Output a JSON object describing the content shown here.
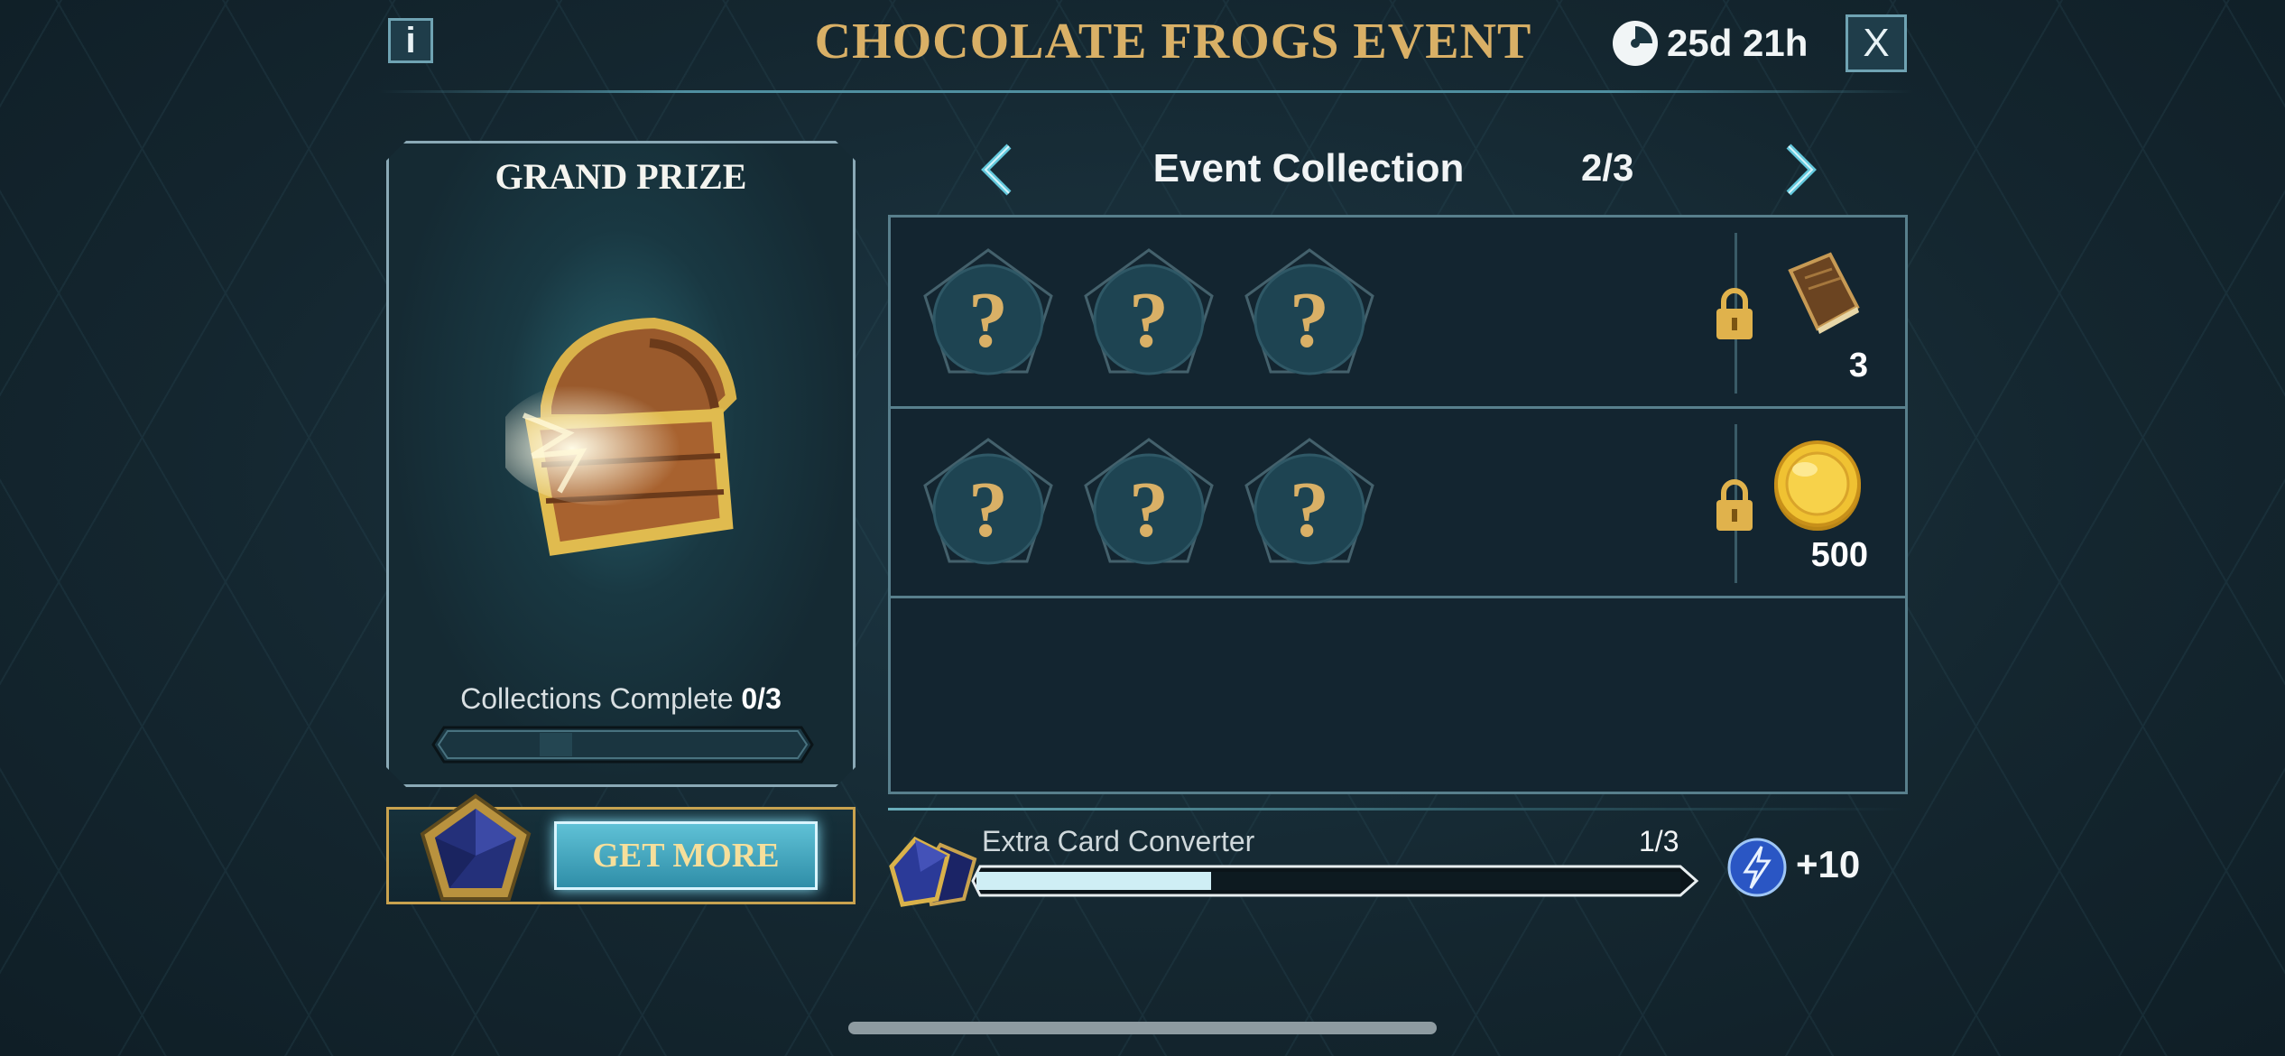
{
  "header": {
    "info_label": "i",
    "title": "CHOCOLATE FROGS EVENT",
    "timer": "25d 21h",
    "close_label": "X"
  },
  "grand_prize": {
    "title": "GRAND PRIZE",
    "collections_label": "Collections Complete",
    "collections_value": "0/3",
    "progress_fraction": 0
  },
  "get_more": {
    "label": "GET MORE"
  },
  "collection": {
    "title": "Event Collection",
    "page": "2/3",
    "rows": [
      {
        "slots": [
          "?",
          "?",
          "?"
        ],
        "locked": true,
        "reward_icon": "book-icon",
        "reward_value": "3"
      },
      {
        "slots": [
          "?",
          "?",
          "?"
        ],
        "locked": true,
        "reward_icon": "gold-coin-icon",
        "reward_value": "500"
      }
    ]
  },
  "converter": {
    "label": "Extra Card Converter",
    "count": "1/3",
    "progress_fraction": 0.333,
    "bonus": "+10",
    "bonus_icon": "lightning-bolt-icon"
  },
  "colors": {
    "gold": "#d9b066",
    "panel_border": "#8aa9b6",
    "accent_cyan": "#5fc1d6"
  }
}
